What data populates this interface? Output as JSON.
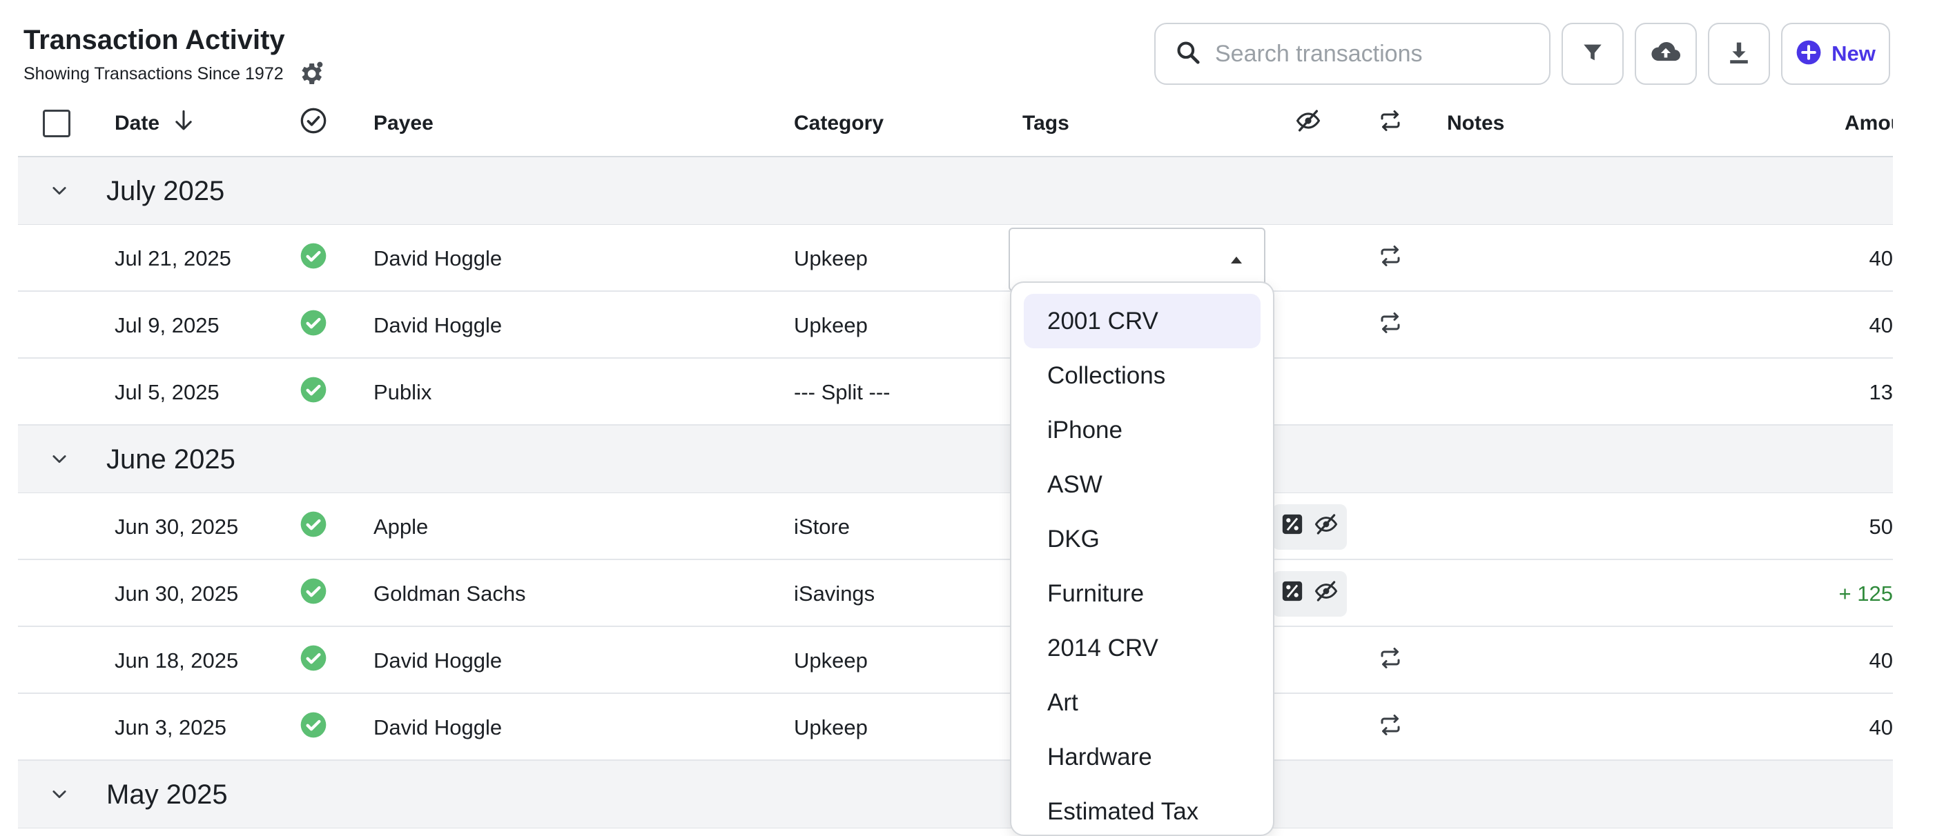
{
  "header": {
    "title": "Transaction Activity",
    "subtitle": "Showing Transactions Since 1972"
  },
  "toolbar": {
    "search_placeholder": "Search transactions",
    "new_label": "New"
  },
  "table": {
    "columns": {
      "date": "Date",
      "payee": "Payee",
      "category": "Category",
      "tags": "Tags",
      "notes": "Notes",
      "amount": "Amount"
    },
    "groups": [
      {
        "label": "July 2025",
        "rows": [
          {
            "date": "Jul 21, 2025",
            "payee": "David Hoggle",
            "category": "Upkeep",
            "repeat": true,
            "flags": false,
            "amount": "40",
            "positive": false
          },
          {
            "date": "Jul 9, 2025",
            "payee": "David Hoggle",
            "category": "Upkeep",
            "repeat": true,
            "flags": false,
            "amount": "40",
            "positive": false
          },
          {
            "date": "Jul 5, 2025",
            "payee": "Publix",
            "category": "--- Split ---",
            "repeat": false,
            "flags": false,
            "amount": "13",
            "positive": false
          }
        ]
      },
      {
        "label": "June 2025",
        "rows": [
          {
            "date": "Jun 30, 2025",
            "payee": "Apple",
            "category": "iStore",
            "repeat": false,
            "flags": true,
            "amount": "50",
            "positive": false
          },
          {
            "date": "Jun 30, 2025",
            "payee": "Goldman Sachs",
            "category": "iSavings",
            "repeat": false,
            "flags": true,
            "amount": "+ 125",
            "positive": true
          },
          {
            "date": "Jun 18, 2025",
            "payee": "David Hoggle",
            "category": "Upkeep",
            "repeat": true,
            "flags": false,
            "amount": "40",
            "positive": false
          },
          {
            "date": "Jun 3, 2025",
            "payee": "David Hoggle",
            "category": "Upkeep",
            "repeat": true,
            "flags": false,
            "amount": "40",
            "positive": false
          }
        ]
      },
      {
        "label": "May 2025",
        "rows": []
      }
    ]
  },
  "tag_dropdown": {
    "options": [
      "2001 CRV",
      "Collections",
      "iPhone",
      "ASW",
      "DKG",
      "Furniture",
      "2014 CRV",
      "Art",
      "Hardware",
      "Estimated Tax"
    ],
    "highlighted_index": 0
  },
  "colors": {
    "accent": "#4a35e6",
    "cleared_green": "#5cbf73",
    "positive_amount": "#2f8a3b",
    "group_background": "#f3f4f6"
  }
}
